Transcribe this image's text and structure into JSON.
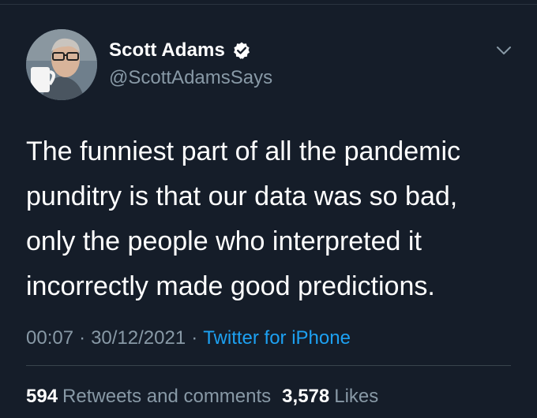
{
  "tweet": {
    "author": {
      "display_name": "Scott Adams",
      "handle": "@ScottAdamsSays",
      "verified": true
    },
    "text_lines": [
      "The funniest part of all the pandemic",
      "punditry is that our data was so bad,",
      "only the people who interpreted it",
      "incorrectly made good predictions."
    ],
    "time": "00:07",
    "separator": "·",
    "date": "30/12/2021",
    "source": "Twitter for iPhone",
    "stats": {
      "retweets_count": "594",
      "retweets_label": "Retweets and comments",
      "likes_count": "3,578",
      "likes_label": "Likes"
    }
  },
  "colors": {
    "background": "#151d29",
    "text_primary": "#ffffff",
    "text_secondary": "#8899a6",
    "accent_link": "#1da1f2",
    "verified_badge": "#ffffff",
    "divider": "#38444d"
  },
  "icons": {
    "verified": "verified-badge-icon",
    "menu": "chevron-down-icon"
  }
}
